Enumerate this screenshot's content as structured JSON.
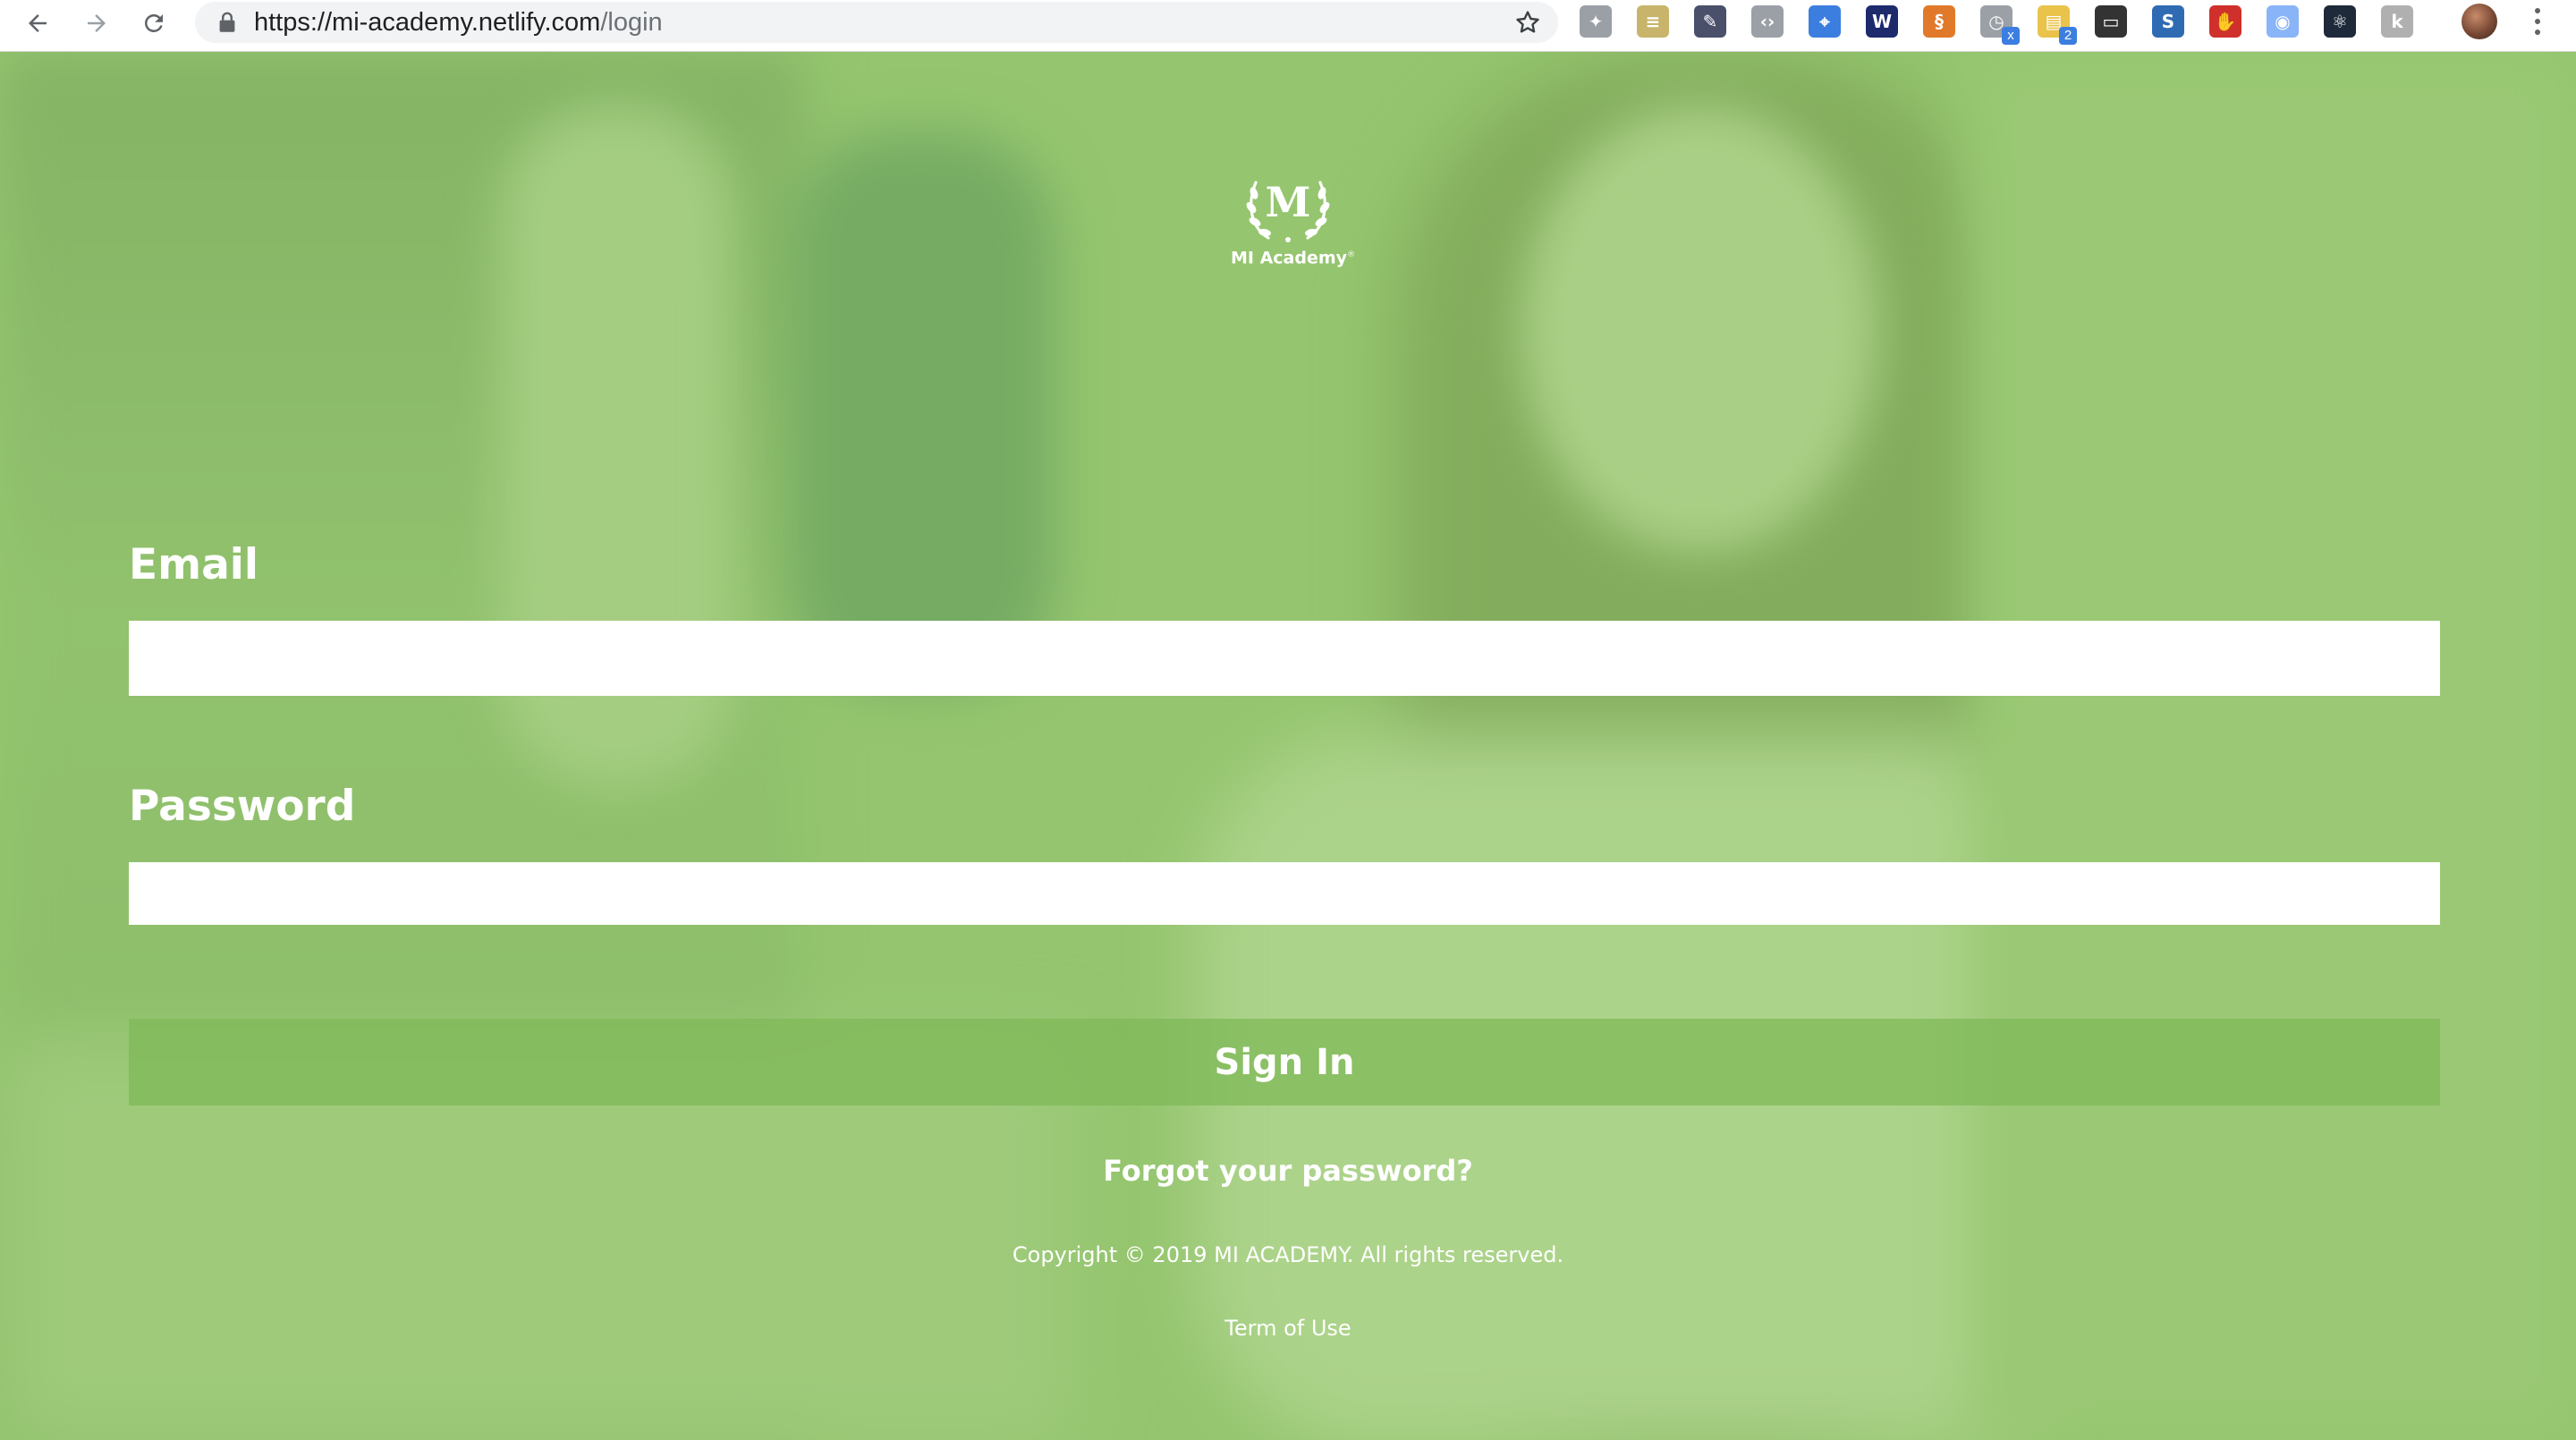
{
  "browser": {
    "url_host": "https://mi-academy.netlify.com",
    "url_path": "/login",
    "extensions": [
      {
        "icon": "puzzle-extension-icon",
        "color": "#9aa0a6"
      },
      {
        "icon": "notepad-extension-icon",
        "color": "#c8b46a"
      },
      {
        "icon": "eyedropper-extension-icon",
        "color": "#4a4f6a"
      },
      {
        "icon": "code-tag-extension-icon",
        "color": "#9aa0a6"
      },
      {
        "icon": "inspect-extension-icon",
        "color": "#3c7ee0"
      },
      {
        "icon": "w-logo-extension-icon",
        "color": "#1d2a6b"
      },
      {
        "icon": "seo-extension-icon",
        "color": "#e07a2a"
      },
      {
        "icon": "clock-extension-icon",
        "color": "#9aa0a6",
        "badge": "x"
      },
      {
        "icon": "window-extension-icon",
        "color": "#e9c34a",
        "badge": "2"
      },
      {
        "icon": "screenshot-extension-icon",
        "color": "#333333"
      },
      {
        "icon": "s-logo-extension-icon",
        "color": "#2f6bb3"
      },
      {
        "icon": "shield-extension-icon",
        "color": "#d0302b"
      },
      {
        "icon": "circle-dot-extension-icon",
        "color": "#8ab4f8"
      },
      {
        "icon": "react-extension-icon",
        "color": "#1e2a3a"
      },
      {
        "icon": "k-extension-icon",
        "color": "#b0b0b0"
      }
    ]
  },
  "login": {
    "logo_letter": "M",
    "logo_name": "MI Academy",
    "logo_mark": "®",
    "email_label": "Email",
    "email_value": "",
    "password_label": "Password",
    "password_value": "",
    "signin_label": "Sign In",
    "forgot_label": "Forgot your password?",
    "copyright": "Copyright © 2019 MI ACADEMY. All rights reserved.",
    "terms_label": "Term of Use"
  },
  "colors": {
    "overlay_green": "#96c66e",
    "button_green": "#7eb858",
    "text_white": "#ffffff"
  }
}
